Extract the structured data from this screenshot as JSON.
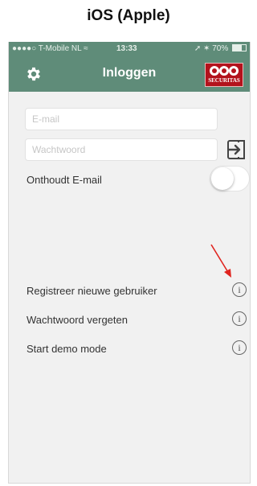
{
  "caption": "iOS (Apple)",
  "status_bar": {
    "carrier": "●●●●○ T-Mobile NL",
    "wifi_icon": "wifi-icon",
    "time": "13:33",
    "location_icon": "location-arrow-icon",
    "bluetooth_icon": "bluetooth-icon",
    "battery_percent": "70%",
    "battery_level": 0.7
  },
  "navbar": {
    "title": "Inloggen",
    "settings_icon": "gear-icon",
    "logo_text": "SECURITAS",
    "background_color": "#5f8c79"
  },
  "form": {
    "email": {
      "value": "",
      "placeholder": "E-mail"
    },
    "password": {
      "value": "",
      "placeholder": "Wachtwoord"
    },
    "login_icon": "login-arrow-icon",
    "remember_label": "Onthoudt E-mail",
    "remember_enabled": false
  },
  "menu": {
    "items": [
      {
        "label": "Registreer nieuwe gebruiker",
        "info": "i"
      },
      {
        "label": "Wachtwoord vergeten",
        "info": "i"
      },
      {
        "label": "Start demo mode",
        "info": "i"
      }
    ]
  },
  "annotation": {
    "arrow_color": "#e0241f"
  }
}
